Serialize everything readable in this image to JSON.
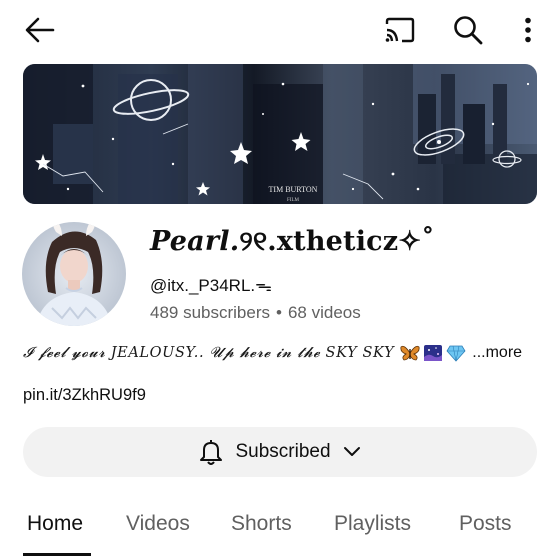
{
  "topbar": {
    "back_icon": "arrow-left-icon",
    "cast_icon": "cast-icon",
    "search_icon": "search-icon",
    "more_icon": "more-vertical-icon"
  },
  "banner": {
    "brand_text_1": "TIM BURTON",
    "brand_text_2": "FILM"
  },
  "channel": {
    "name_script": "Pearl.",
    "name_rest": "୨୧.xtheticz✧˚",
    "handle": "@itx._P34RL.ᯓ",
    "subscribers": "489 subscribers",
    "separator": "•",
    "videos": "68 videos",
    "description": "𝓘 𝓯𝓮𝓮𝓵 𝔂𝓸𝓾𝓻 JEALOUSY.. 𝓤𝓹 𝓱𝓮𝓻𝓮 𝓲𝓷 𝓽𝓱𝓮 SKY SKY",
    "description_emojis": [
      "butterfly-icon",
      "night-sky-icon",
      "gem-icon"
    ],
    "more_label": "...more",
    "link": "pin.it/3ZkhRU9f9"
  },
  "subscribe": {
    "label": "Subscribed",
    "bell_icon": "bell-icon",
    "chevron_icon": "chevron-down-icon"
  },
  "tabs": [
    {
      "label": "Home",
      "active": true
    },
    {
      "label": "Videos",
      "active": false
    },
    {
      "label": "Shorts",
      "active": false
    },
    {
      "label": "Playlists",
      "active": false
    },
    {
      "label": "Posts",
      "active": false
    }
  ]
}
